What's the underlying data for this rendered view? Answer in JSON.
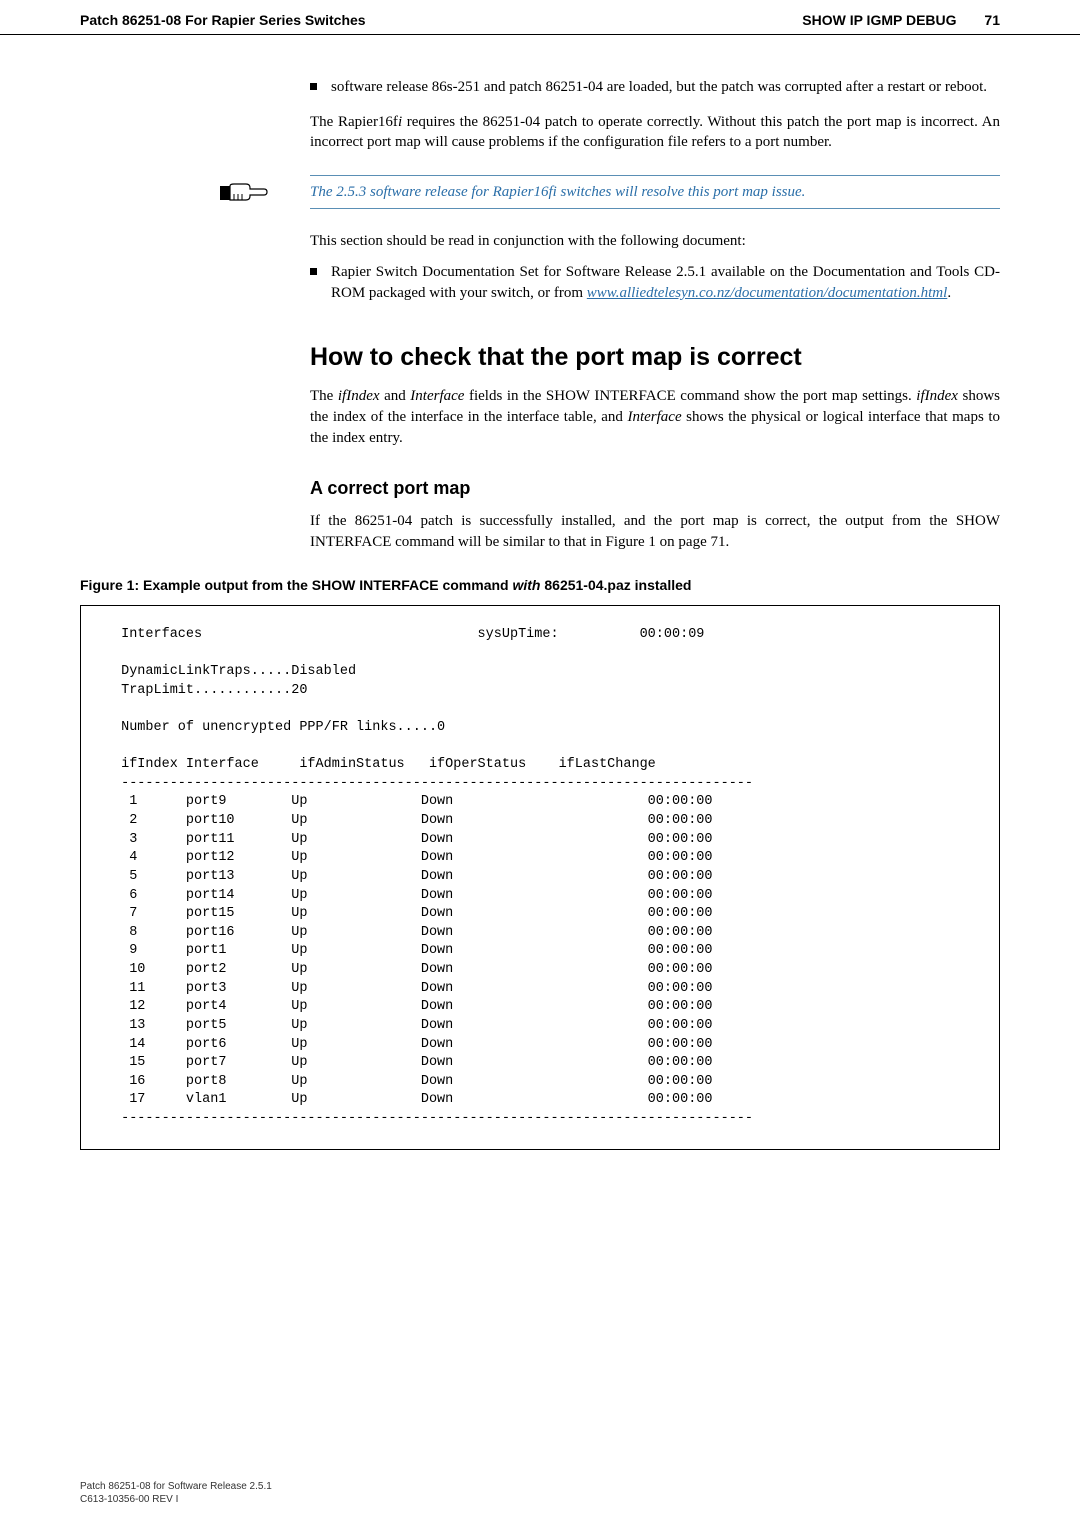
{
  "header": {
    "left": "Patch 86251-08 For Rapier Series Switches",
    "right_label": "SHOW IP IGMP DEBUG",
    "page_num": "71"
  },
  "bullets": {
    "b1": "software release 86s-251 and patch 86251-04 are loaded, but the patch was corrupted after a restart or reboot."
  },
  "paras": {
    "p1a": "The Rapier16f",
    "p1b": "i",
    "p1c": " requires the 86251-04 patch to operate correctly. Without this patch the port map is incorrect. An incorrect port map will cause problems if the configuration file refers to a port number.",
    "callout": "The 2.5.3 software release for Rapier16fi switches will resolve this port map issue.",
    "p2": "This section should be read in conjunction with the following document:",
    "b2": "Rapier Switch Documentation Set for Software Release 2.5.1 available on the Documentation and Tools CD-ROM packaged with your switch, or from ",
    "link": "www.alliedtelesyn.co.nz/documentation/documentation.html",
    "period": "."
  },
  "section": {
    "heading": "How to check that the port map is correct",
    "p3a": "The ",
    "p3b": "ifIndex",
    "p3c": " and ",
    "p3d": "Interface",
    "p3e": " fields in the SHOW INTERFACE command show the port map settings. ",
    "p3f": "ifIndex",
    "p3g": " shows the index of the interface in the interface table, and ",
    "p3h": "Interface",
    "p3i": " shows the physical or logical interface that maps to the index entry."
  },
  "subsection": {
    "heading": "A correct port map",
    "p4": "If the 86251-04 patch is successfully installed, and the port map is correct, the output from the SHOW INTERFACE command will be similar to that in Figure 1 on page 71."
  },
  "figure": {
    "caption_a": "Figure 1: Example output from the SHOW INTERFACE command ",
    "caption_b": "with",
    "caption_c": " 86251-04.paz installed"
  },
  "code": {
    "line01": " Interfaces                                  sysUpTime:          00:00:09",
    "line02": "",
    "line03": " DynamicLinkTraps.....Disabled",
    "line04": " TrapLimit............20",
    "line05": "",
    "line06": " Number of unencrypted PPP/FR links.....0",
    "line07": "",
    "line08": " ifIndex Interface     ifAdminStatus   ifOperStatus    ifLastChange",
    "line09": " ------------------------------------------------------------------------------",
    "line10": "  1      port9        Up              Down                        00:00:00",
    "line11": "  2      port10       Up              Down                        00:00:00",
    "line12": "  3      port11       Up              Down                        00:00:00",
    "line13": "  4      port12       Up              Down                        00:00:00",
    "line14": "  5      port13       Up              Down                        00:00:00",
    "line15": "  6      port14       Up              Down                        00:00:00",
    "line16": "  7      port15       Up              Down                        00:00:00",
    "line17": "  8      port16       Up              Down                        00:00:00",
    "line18": "  9      port1        Up              Down                        00:00:00",
    "line19": "  10     port2        Up              Down                        00:00:00",
    "line20": "  11     port3        Up              Down                        00:00:00",
    "line21": "  12     port4        Up              Down                        00:00:00",
    "line22": "  13     port5        Up              Down                        00:00:00",
    "line23": "  14     port6        Up              Down                        00:00:00",
    "line24": "  15     port7        Up              Down                        00:00:00",
    "line25": "  16     port8        Up              Down                        00:00:00",
    "line26": "  17     vlan1        Up              Down                        00:00:00",
    "line27": " ------------------------------------------------------------------------------"
  },
  "footer": {
    "line1": "Patch 86251-08 for Software Release 2.5.1",
    "line2": "C613-10356-00 REV I"
  }
}
